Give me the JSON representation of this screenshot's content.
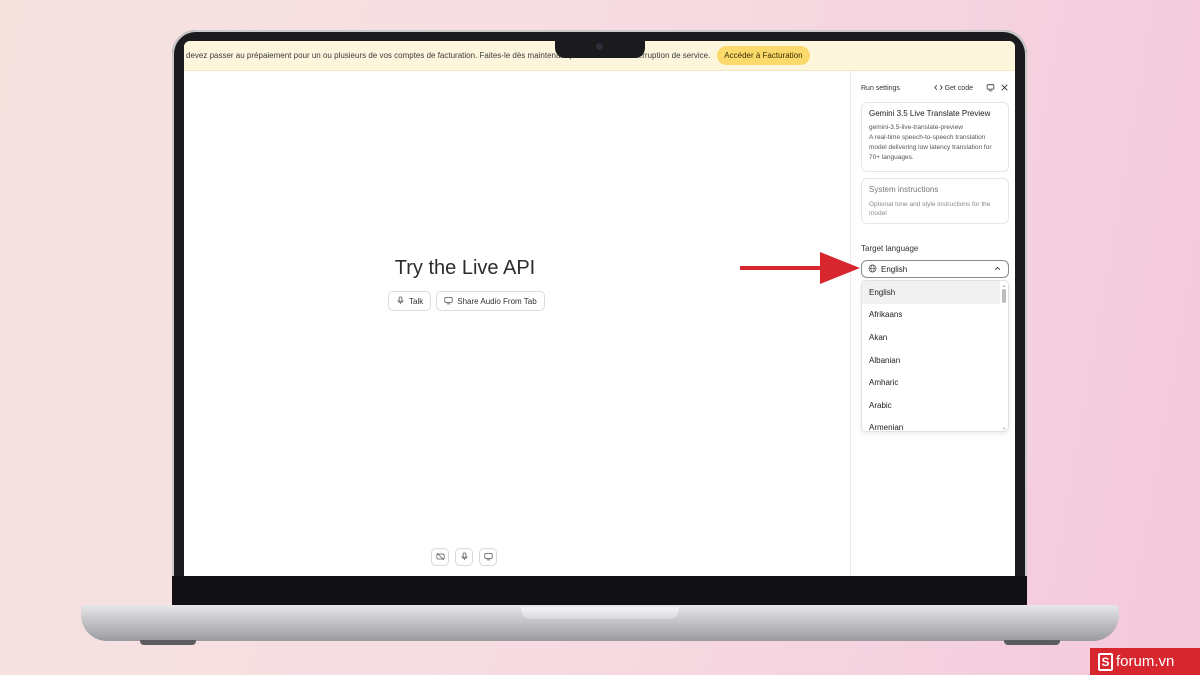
{
  "banner": {
    "text": "devez passer au prépaiement pour un ou plusieurs de vos comptes de facturation. Faites-le dès maintenant pour éviter toute interruption de service.",
    "button_label": "Accéder à Facturation"
  },
  "main": {
    "title": "Try the Live API",
    "talk_label": "Talk",
    "share_label": "Share Audio From Tab"
  },
  "panel": {
    "run_settings": "Run settings",
    "get_code": "Get code",
    "model": {
      "name": "Gemini 3.5 Live Translate Preview",
      "id": "gemini-3.5-live-translate-preview",
      "description": "A real-time speech-to-speech translation model delivering low latency translation for 70+ languages."
    },
    "system_instructions": {
      "title": "System instructions",
      "placeholder": "Optional tone and style instructions for the model"
    },
    "target_language": {
      "label": "Target language",
      "selected": "English",
      "options": [
        "English",
        "Afrikaans",
        "Akan",
        "Albanian",
        "Amharic",
        "Arabic",
        "Armenian"
      ]
    }
  },
  "watermark": {
    "logo_letter": "S",
    "text": "forum.vn"
  },
  "colors": {
    "banner_bg": "#fdf6dd",
    "banner_button": "#fbd96a",
    "arrow": "#d7262d",
    "watermark_bg": "#d7262d"
  },
  "icons": [
    "mic-icon",
    "monitor-icon",
    "code-icon",
    "compare-icon",
    "close-icon",
    "globe-icon",
    "chevron-up-icon",
    "captions-off-icon"
  ]
}
